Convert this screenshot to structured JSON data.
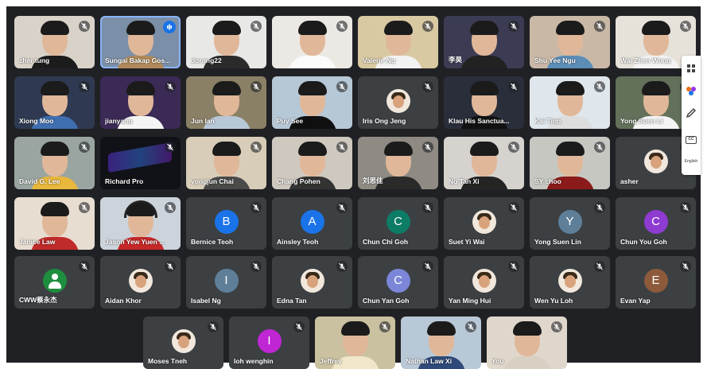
{
  "participants_row1": [
    {
      "name": "zher tung",
      "bg": "#d9d2c8",
      "shirt": "#1c1c1c"
    },
    {
      "name": "Sungai Bakap Gos...",
      "bg": "#7c8fa8",
      "shirt": "#b08a5a",
      "speaking": true
    },
    {
      "name": "dorong22",
      "bg": "#e8e8e6",
      "shirt": "#2b2b2b"
    },
    {
      "name": "",
      "bg": "#ece8e3",
      "shirt": "#fafafa"
    },
    {
      "name": "Valerie Ng",
      "bg": "#d9c9a3",
      "shirt": "#f2f2f2"
    },
    {
      "name": "李昊",
      "bg": "#3b3c54",
      "shirt": "#222"
    },
    {
      "name": "Shu Yee Ngu",
      "bg": "#c9b8a6",
      "shirt": "#5b8db7"
    },
    {
      "name": "Wai Zhen Wong",
      "bg": "#e6e2da",
      "shirt": "#f3f3f3"
    }
  ],
  "participants_row2": [
    {
      "name": "Xiong Moo",
      "bg": "#2f3a52",
      "shirt": "#3f6fb1"
    },
    {
      "name": "jianyang",
      "bg": "#3b2a55",
      "shirt": "#f4f4f4"
    },
    {
      "name": "Jun Ian",
      "bg": "#8a8066",
      "shirt": "#b8c7d6"
    },
    {
      "name": "Puy See",
      "bg": "#b6c7d6",
      "shirt": "#0f0f0f"
    },
    {
      "name": "Iris Ong Jeng",
      "bg": "#3c4043",
      "avatar": "photo"
    },
    {
      "name": "Klau His Sanctua...",
      "bg": "#2a2e3a",
      "shirt": "#111"
    },
    {
      "name": "Kai Ting",
      "bg": "#dfe7ec",
      "shirt": "#ddd"
    },
    {
      "name": "Yong Suen Li",
      "bg": "#63705a",
      "shirt": "#f4f4f4"
    }
  ],
  "participants_row3": [
    {
      "name": "David G. Lee",
      "bg": "#9aa5a2",
      "shirt": "#e9b73c"
    },
    {
      "name": "Richard Pro",
      "bg": "#111118",
      "shirt": "#1a1a1a",
      "keyboard": true
    },
    {
      "name": "yongjun Chai",
      "bg": "#d8cdb9",
      "shirt": "#4a4a4a"
    },
    {
      "name": "Chang Pohen",
      "bg": "#cfc8bf",
      "shirt": "#333"
    },
    {
      "name": "刘思佳",
      "bg": "#8f8b84",
      "shirt": "#2a2a2a"
    },
    {
      "name": "Ng Tan Xi",
      "bg": "#d6d3cf",
      "shirt": "#242424"
    },
    {
      "name": "SY choo",
      "bg": "#c7c7c2",
      "shirt": "#8b1a1a"
    },
    {
      "name": "asher",
      "bg": "#3c4043",
      "avatar": "photo"
    }
  ],
  "participants_row4": [
    {
      "name": "Janice Law",
      "bg": "#e7ddd1",
      "shirt": "#c12a2a"
    },
    {
      "name": "Jason Yew Yuen ...",
      "bg": "#ccd3db",
      "shirt": "#c62828",
      "headset": true
    },
    {
      "name": "Bernice Teoh",
      "bg": "#3c4043",
      "avatar": "letter",
      "letter": "B",
      "color": "#1a73e8"
    },
    {
      "name": "Ainsley Teoh",
      "bg": "#3c4043",
      "avatar": "letter",
      "letter": "A",
      "color": "#1a73e8"
    },
    {
      "name": "Chun Chi Goh",
      "bg": "#3c4043",
      "avatar": "letter",
      "letter": "C",
      "color": "#0d7c66"
    },
    {
      "name": "Suet Yi Wai",
      "bg": "#3c4043",
      "avatar": "photo"
    },
    {
      "name": "Yong Suen Lin",
      "bg": "#3c4043",
      "avatar": "letter",
      "letter": "Y",
      "color": "#5f7f99"
    },
    {
      "name": "Chun You Goh",
      "bg": "#3c4043",
      "avatar": "letter",
      "letter": "C",
      "color": "#8e3bd1"
    }
  ],
  "participants_row5": [
    {
      "name": "CWW蔡永杰",
      "bg": "#3c4043",
      "avatar": "generic"
    },
    {
      "name": "Aidan Khor",
      "bg": "#3c4043",
      "avatar": "photo"
    },
    {
      "name": "Isabel Ng",
      "bg": "#3c4043",
      "avatar": "letter",
      "letter": "I",
      "color": "#5f7f99"
    },
    {
      "name": "Edna Tan",
      "bg": "#3c4043",
      "avatar": "photo"
    },
    {
      "name": "Chun Yan Goh",
      "bg": "#3c4043",
      "avatar": "letter",
      "letter": "C",
      "color": "#7b86d8"
    },
    {
      "name": "Yan Ming Hui",
      "bg": "#3c4043",
      "avatar": "photo"
    },
    {
      "name": "Wen Yu Loh",
      "bg": "#3c4043",
      "avatar": "photo"
    },
    {
      "name": "Evan Yap",
      "bg": "#3c4043",
      "avatar": "letter",
      "letter": "E",
      "color": "#8d5a3c"
    }
  ],
  "participants_row6": [
    {
      "name": "Moses Tneh",
      "bg": "#3c4043",
      "avatar": "photo"
    },
    {
      "name": "loh wenghin",
      "bg": "#3c4043",
      "avatar": "letter",
      "letter": "I",
      "color": "#c026d3"
    },
    {
      "name": "Jeffrey",
      "bg": "#c9c1a0",
      "shirt": "#f1e6c8"
    },
    {
      "name": "Nathan Law Xi",
      "bg": "#b9c8d6",
      "shirt": "#2f4a7a"
    },
    {
      "name": "You",
      "bg": "#e0d7cc",
      "shirt": "#d9d0c4"
    }
  ],
  "side_panel": {
    "grid_icon": "grid-icon",
    "activities_icon": "activities-icon",
    "pen_icon": "pen-icon",
    "captions_label": "CC",
    "language_label": "English"
  }
}
